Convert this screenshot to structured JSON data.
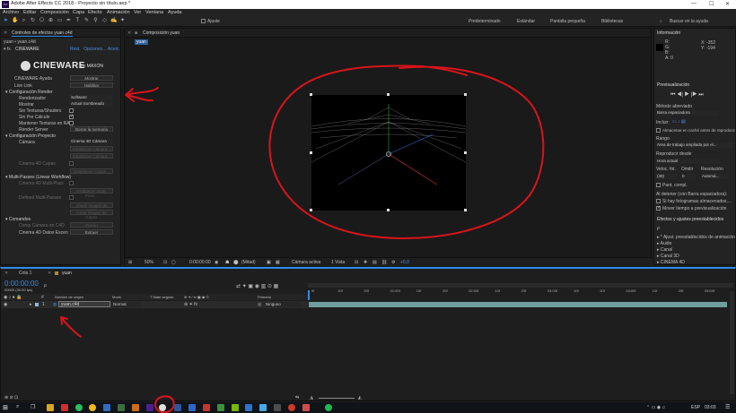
{
  "window": {
    "title": "Adobe After Effects CC 2018 - Proyecto sin título.aep *",
    "app_badge": "Ae"
  },
  "menu": [
    "Archivo",
    "Editar",
    "Composición",
    "Capa",
    "Efecto",
    "Animación",
    "Ver",
    "Ventana",
    "Ayuda"
  ],
  "toolbar": {
    "ajuste": "Ajuste",
    "workspaces": [
      "Predeterminado",
      "Estándar",
      "Pantalla pequeña",
      "Bibliotecas"
    ],
    "search_placeholder": "Buscar en la ayuda"
  },
  "effects_panel": {
    "tab_label": "Controles de efectos yuan.c4d",
    "layer_path": "yuan • yuan.c4d",
    "effect_name": "CINEWARE",
    "header_links": [
      "Rest.",
      "Opciones...",
      "Acerc"
    ],
    "logo_text": "CINEWARE",
    "logo_by": "by MAXON",
    "rows": {
      "ayuda": "CINEWARE Ayuda",
      "ayuda_btn": "Mostrar",
      "live_link": "Live Link",
      "live_link_btn": "Habilitar",
      "config_render": "Configuración Render",
      "renderizador": "Renderizador",
      "renderizador_val": "Software",
      "mostrar": "Mostrar",
      "mostrar_val": "Actual Sombreado",
      "sin_texturas": "Sin Texturas/Shaders",
      "sin_precalculo": "Sin Pre Cálculo",
      "mantener_texturas": "Mantener Texturas en RA",
      "render_server": "Render Server",
      "render_server_btn": "Borrar la memoria",
      "config_proyecto": "Configuración Proyecto",
      "camara": "Cámara",
      "camara_val": "Cinema 4D Cámara",
      "camara_btn1": "Establecer Cámara...",
      "camara_btn2": "Establecer Cámara...",
      "c4d_capas": "Cinema 4D Capas",
      "c4d_capas_btn": "Establecer Capas...",
      "multipases": "Multi-Passes (Linear Workflow)",
      "multipases_row": "Cinema 4D Multi-Pass",
      "multipases_btn": "Establecer Multi-Pass...",
      "defined_multipasses": "Defined Multi-Passes",
      "add_image_layers": "Añadir imagen de capas",
      "crear_capas": "Crear imagen de Capas",
      "comandos": "Comandos",
      "comp_camera": "Comp Cámara en C4D",
      "comp_camera_btn": "Fusión",
      "extract": "Cinema 4D Datos Escen",
      "extract_btn": "Extraer"
    }
  },
  "comp_panel": {
    "tab_label": "Composición yuan",
    "breadcrumb": "yuan",
    "footer": {
      "zoom": "50%",
      "timecode": "0:00:00:00",
      "resolution": "(Mitad)",
      "camera": "Cámara activa",
      "views": "1 Vista",
      "exposure": "+0,0"
    }
  },
  "info_panel": {
    "title": "Información",
    "r": "R:",
    "g": "G:",
    "b": "B:",
    "a": "A: 0",
    "x": "X: -352",
    "y": "Y: -194"
  },
  "preview_panel": {
    "title": "Previsualización",
    "shortcut_label": "Método abreviado",
    "shortcut_val": "Barra espaciadora",
    "include_label": "Incluir:",
    "cache_label": "Almacenar en caché antes de reproducir",
    "range_label": "Rango",
    "range_val": "Área de trabajo ampliada por el...",
    "play_from_label": "Reproducir desde",
    "play_from_val": "Hora actual",
    "fps_label": "Veloc. fot.",
    "skip_label": "Omitir",
    "res_label": "Resolución",
    "fps_val": "(30)",
    "skip_val": "0",
    "res_val": "Automá...",
    "fullscreen": "Pant. compl.",
    "on_stop": "Al detener (con Barra espaciadora):",
    "cached": "Si hay fotogramas almacenados,...",
    "move_time": "Mover tiempo a previsualización"
  },
  "effects_presets": {
    "title": "Efectos y ajustes preestablecidos",
    "search": "ρ",
    "items": [
      "* Ajust. preestablecidos de animación",
      "Audio",
      "Canal",
      "Canal 3D",
      "CINEMA 4D"
    ]
  },
  "timeline": {
    "tabs": [
      "Cola 1",
      "yuan"
    ],
    "timecode": "0:00:00:00",
    "fps_info": "00000 (30.00 fps)",
    "search": "ρ",
    "columns": {
      "source": "Nombre de origen",
      "mode": "Modo",
      "track": "T Mate seguim.",
      "parent": "Primaria"
    },
    "ruler": [
      "0f",
      "10f",
      "20f",
      "01:00f",
      "10f",
      "20f",
      "02:00f",
      "10f",
      "20f",
      "03:00f",
      "10f",
      "20f",
      "04:00f",
      "10f",
      "20f",
      "05:00f"
    ],
    "layer": {
      "index": "1",
      "name": "yuan.c4d",
      "mode": "Normal",
      "parent": "Ninguno"
    }
  },
  "taskbar": {
    "lang": "ESP",
    "time": "03:03"
  },
  "colors": {
    "annotation": "#d8141b",
    "accent": "#2d8ceb",
    "bg": "#232323"
  }
}
